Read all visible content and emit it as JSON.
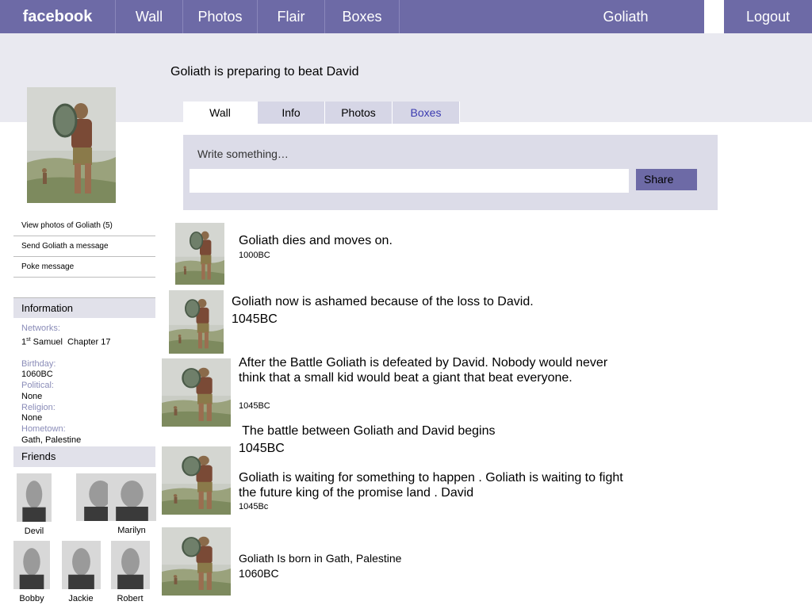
{
  "topnav": {
    "brand": "facebook",
    "items": [
      "Wall",
      "Photos",
      "Flair",
      "Boxes"
    ],
    "user": "Goliath",
    "logout": "Logout"
  },
  "profile": {
    "status": "Goliath is preparing to beat David"
  },
  "tabs": [
    "Wall",
    "Info",
    "Photos",
    "Boxes"
  ],
  "composer": {
    "prompt": "Write something…",
    "share_label": "Share"
  },
  "left_links": [
    "View photos of Goliath (5)",
    "Send Goliath a message",
    "Poke message"
  ],
  "information": {
    "heading": "Information",
    "networks_label": "Networks:",
    "networks_prefix": "1",
    "networks_sup": "st",
    "networks_rest": " Samuel  Chapter 17",
    "birthday_label": "Birthday:",
    "birthday_value": "1060BC",
    "political_label": "Political:",
    "political_value": "None",
    "religion_label": "Religion:",
    "religion_value": "None",
    "hometown_label": "Hometown:",
    "hometown_value": "Gath, Palestine"
  },
  "friends": {
    "heading": "Friends",
    "items": [
      {
        "name": "Devil"
      },
      {
        "name": ""
      },
      {
        "name": "Marilyn"
      },
      {
        "name": "Bobby"
      },
      {
        "name": "Jackie"
      },
      {
        "name": "Robert"
      }
    ]
  },
  "wall_posts": [
    {
      "text": "Goliath dies and moves on.",
      "date": "1000BC"
    },
    {
      "text": "Goliath now is ashamed because of the loss to David.",
      "date": "1045BC"
    },
    {
      "text": "After the Battle Goliath is defeated by David. Nobody would never think that a small kid would beat a giant that beat everyone.",
      "date": "1045BC"
    },
    {
      "text": " The battle between Goliath and David begins",
      "date": "1045BC"
    },
    {
      "text": "Goliath is waiting for something to happen . Goliath is waiting to fight the future king of the promise land . David",
      "date": "1045Bc"
    },
    {
      "text": "Goliath Is born in Gath, Palestine",
      "date": "1060BC"
    }
  ],
  "colors": {
    "nav": "#6d6aa6",
    "band": "#e9e9f0",
    "composer": "#dcdce8",
    "label": "#8a8cb8",
    "active_link": "#3b3bb0"
  }
}
